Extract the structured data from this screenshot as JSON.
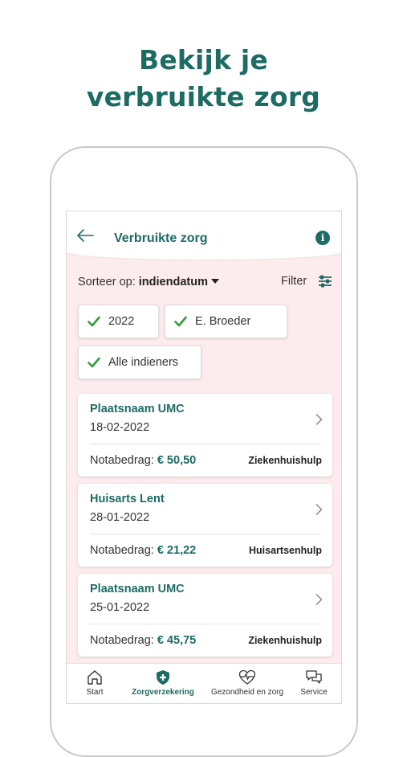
{
  "headline": {
    "line1": "Bekijk je",
    "line2": "verbruikte zorg"
  },
  "header": {
    "title": "Verbruikte zorg"
  },
  "sort": {
    "label": "Sorteer op:",
    "value": "indiendatum"
  },
  "filter": {
    "label": "Filter"
  },
  "chips": [
    "2022",
    "E. Broeder",
    "Alle indieners"
  ],
  "claims": [
    {
      "name": "Plaatsnaam UMC",
      "date": "18-02-2022",
      "amount_label": "Notabedrag:",
      "amount": "€ 50,50",
      "type": "Ziekenhuishulp"
    },
    {
      "name": "Huisarts Lent",
      "date": "28-01-2022",
      "amount_label": "Notabedrag:",
      "amount": "€ 21,22",
      "type": "Huisartsenhulp"
    },
    {
      "name": "Plaatsnaam UMC",
      "date": "25-01-2022",
      "amount_label": "Notabedrag:",
      "amount": "€ 45,75",
      "type": "Ziekenhuishulp"
    }
  ],
  "tabs": [
    {
      "label": "Start",
      "icon": "home-icon",
      "active": false
    },
    {
      "label": "Zorgverzekering",
      "icon": "shield-plus-icon",
      "active": true
    },
    {
      "label": "Gezondheid en zorg",
      "icon": "heartbeat-icon",
      "active": false
    },
    {
      "label": "Service",
      "icon": "chat-icon",
      "active": false
    }
  ],
  "colors": {
    "brand": "#1d6b63",
    "check": "#2e9e3e",
    "background": "#fdeced"
  }
}
